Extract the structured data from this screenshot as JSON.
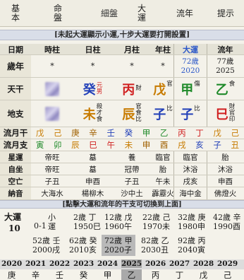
{
  "tabs": [
    {
      "label_a": "基",
      "label_b": "本"
    },
    {
      "label_a": "命",
      "label_b": "盤"
    },
    {
      "label": "細盤"
    },
    {
      "label_a": "大",
      "label_b": "運"
    },
    {
      "label": "流年"
    },
    {
      "label": "提示"
    }
  ],
  "banner_top": "[未起大運顯示小運,十步大運要打開設置]",
  "headers": {
    "label": "日期",
    "hour": "時柱",
    "day": "日柱",
    "month": "月柱",
    "year": "年柱",
    "dayun": "大運",
    "liunian": "流年"
  },
  "age_row": {
    "label": "歲年",
    "hour": "*",
    "day": "*",
    "month": "*",
    "year": "*",
    "dayun_age": "72歲",
    "dayun_year": "2020",
    "ln_age": "77歲",
    "ln_year": "2025"
  },
  "tiangan": {
    "label": "天干",
    "day": "癸",
    "day_sub1": "元",
    "day_sub2": "男",
    "month": "丙",
    "month_sub": "財",
    "year": "戊",
    "year_sub": "官",
    "dayun": "甲",
    "dayun_sub": "傷",
    "liunian": "乙",
    "liunian_sub": "食"
  },
  "dizhi": {
    "label": "地支",
    "day": "未",
    "day_sub": [
      "殺",
      "才",
      "食"
    ],
    "month": "辰",
    "month_sub": [
      "官",
      "食",
      "比"
    ],
    "year": "子",
    "year_sub": "比",
    "dayun": "子",
    "dayun_sub": "比",
    "liunian": "巳",
    "liunian_sub": [
      "財",
      "官",
      "印"
    ]
  },
  "liuyue_gan": {
    "label": "流月干",
    "items": [
      "戊",
      "己",
      "庚",
      "辛",
      "壬",
      "癸",
      "甲",
      "乙",
      "丙",
      "丁",
      "戊",
      "己"
    ]
  },
  "liuyue_zhi": {
    "label": "流月支",
    "items": [
      "寅",
      "卯",
      "辰",
      "巳",
      "午",
      "未",
      "申",
      "酉",
      "戌",
      "亥",
      "子",
      "丑"
    ]
  },
  "xingyun": {
    "label": "星運",
    "hour": "帝旺",
    "day": "墓",
    "month": "養",
    "year": "臨官",
    "dayun": "臨官",
    "liunian": "胎"
  },
  "zizuo": {
    "label": "自坐",
    "hour": "帝旺",
    "day": "墓",
    "month": "冠帶",
    "year": "胎",
    "dayun": "沐浴",
    "liunian": "沐浴"
  },
  "kongwang": {
    "label": "空亡",
    "hour": "子丑",
    "day": "申酉",
    "month": "子丑",
    "year": "午未",
    "dayun": "戌亥",
    "liunian": "申酉"
  },
  "nayin": {
    "label": "納音",
    "hour": "大海水",
    "day": "楊柳木",
    "month": "沙中土",
    "year": "霹靂火",
    "dayun": "海中金",
    "liunian": "佛燈火"
  },
  "banner_mid": "[點擊大運和流年的干支可切換到上面]",
  "luck": {
    "label_a": "大運",
    "label_b": "10",
    "items": [
      {
        "age": "0-1",
        "a": "小",
        "b": "運"
      },
      {
        "a": "2歲 丁",
        "b": "1950巳"
      },
      {
        "a": "12歲 戊",
        "b": "1960午"
      },
      {
        "a": "22歲 己",
        "b": "1970未"
      },
      {
        "a": "32歲 庚",
        "b": "1980申"
      },
      {
        "a": "42歲 辛",
        "b": "1990酉"
      },
      {
        "a": "52歲 壬",
        "b": "2000戌"
      },
      {
        "a": "62歲 癸",
        "b": "2010亥"
      },
      {
        "a": "72歲 甲",
        "b": "2020子"
      },
      {
        "a": "82歲 乙",
        "b": "2030丑"
      },
      {
        "a": "92歲 丙",
        "b": "2040寅"
      }
    ]
  },
  "years": [
    "2020",
    "2021",
    "2022",
    "2023",
    "2024",
    "2025",
    "2026",
    "2027",
    "2028",
    "2029"
  ],
  "year_stems": [
    "庚",
    "辛",
    "壬",
    "癸",
    "甲",
    "乙",
    "丙",
    "丁",
    "戊",
    "己"
  ],
  "colors": {
    "fire": "#d02020",
    "wood": "#1f8a2a",
    "water": "#2240b8",
    "earth": "#c77b00",
    "metal": "#a06000"
  }
}
